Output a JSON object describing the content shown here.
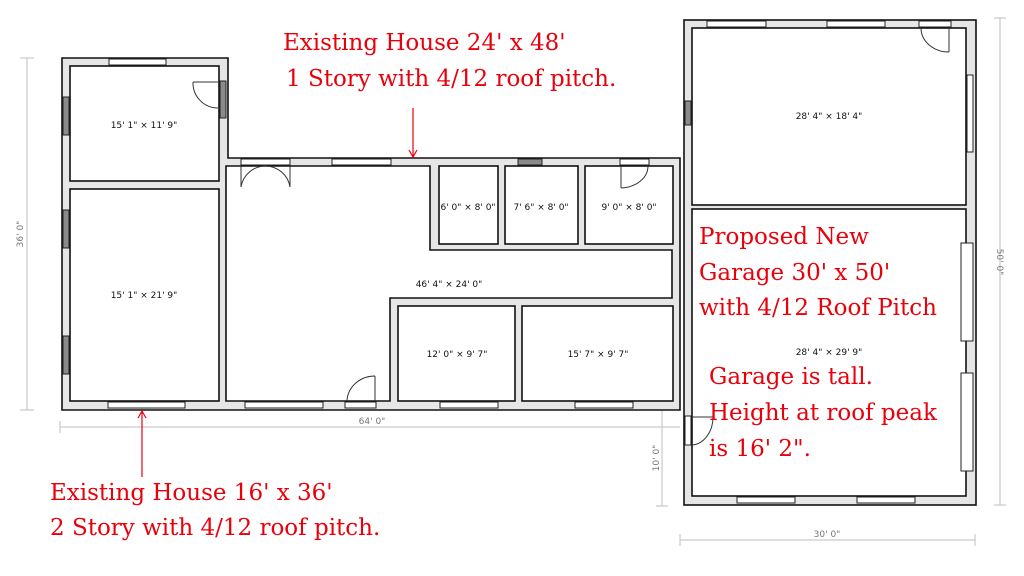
{
  "diagram": {
    "type": "floor-plan",
    "annotations": {
      "existing_house_main": {
        "line1": "Existing House 24' x 48'",
        "line2": "1 Story with 4/12 roof pitch."
      },
      "existing_house_two_story": {
        "line1": "Existing House 16' x 36'",
        "line2": "2 Story with 4/12 roof pitch."
      },
      "proposed_garage": {
        "line1": "Proposed New",
        "line2": "Garage 30' x 50'",
        "line3": "with 4/12 Roof Pitch"
      },
      "garage_height": {
        "line1": "Garage is tall.",
        "line2": "Height at roof peak",
        "line3": "is 16' 2\"."
      }
    },
    "rooms": [
      {
        "id": "bedroom-top-left",
        "label": "15' 1\" × 11' 9\""
      },
      {
        "id": "bedroom-bottom-left",
        "label": "15' 1\" × 21' 9\""
      },
      {
        "id": "main-living",
        "label": "46' 4\" × 24' 0\""
      },
      {
        "id": "closet-1",
        "label": "6' 0\" × 8' 0\""
      },
      {
        "id": "closet-2",
        "label": "7' 6\" × 8' 0\""
      },
      {
        "id": "closet-3",
        "label": "9' 0\" × 8' 0\""
      },
      {
        "id": "room-bottom-middle",
        "label": "12' 0\" × 9' 7\""
      },
      {
        "id": "room-bottom-right",
        "label": "15' 7\" × 9' 7\""
      },
      {
        "id": "garage-upper",
        "label": "28' 4\" × 18' 4\""
      },
      {
        "id": "garage-lower",
        "label": "28' 4\" × 29' 9\""
      }
    ],
    "dimensions": {
      "house_height": "36' 0\"",
      "house_width": "64' 0\"",
      "garage_height": "50' 0\"",
      "garage_width": "30' 0\"",
      "garage_offset": "10' 0\""
    }
  }
}
